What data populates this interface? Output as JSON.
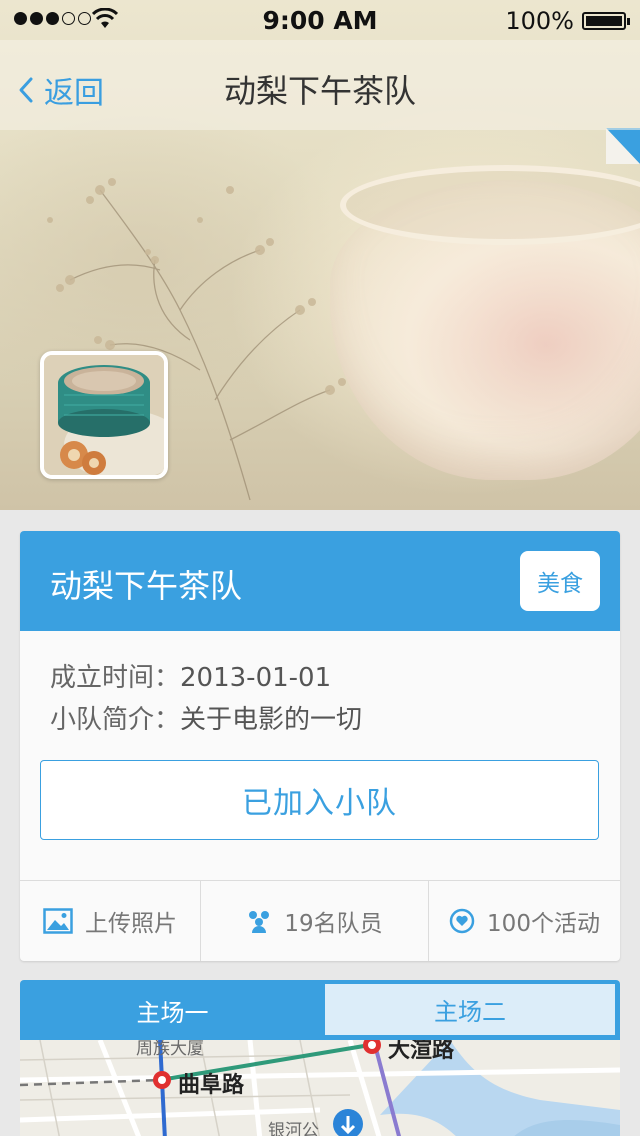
{
  "status_bar": {
    "time": "9:00 AM",
    "battery": "100%"
  },
  "nav": {
    "back_label": "返回",
    "title": "动梨下午茶队"
  },
  "team": {
    "name": "动梨下午茶队",
    "category": "美食",
    "founded_label": "成立时间：",
    "founded_value": "2013-01-01",
    "intro_label": "小队简介：",
    "intro_value": "关于电影的一切",
    "join_button": "已加入小队"
  },
  "stats": {
    "upload_photo": "上传照片",
    "members": "19名队员",
    "activities": "100个活动"
  },
  "map": {
    "tabs": [
      "主场一",
      "主场二"
    ],
    "active_tab": 0,
    "labels": {
      "road1": "曲阜路",
      "road2": "大渲路",
      "road3": "银河公",
      "road4": "周族大厦"
    }
  },
  "colors": {
    "accent": "#3aa0e0",
    "tab_inactive_bg": "#dcedf9",
    "card_bg": "#fafafa",
    "page_bg": "#e8e8e8"
  },
  "icons": {
    "back": "chevron-left-icon",
    "photo": "image-icon",
    "members": "people-icon",
    "activities": "heart-circle-icon"
  }
}
